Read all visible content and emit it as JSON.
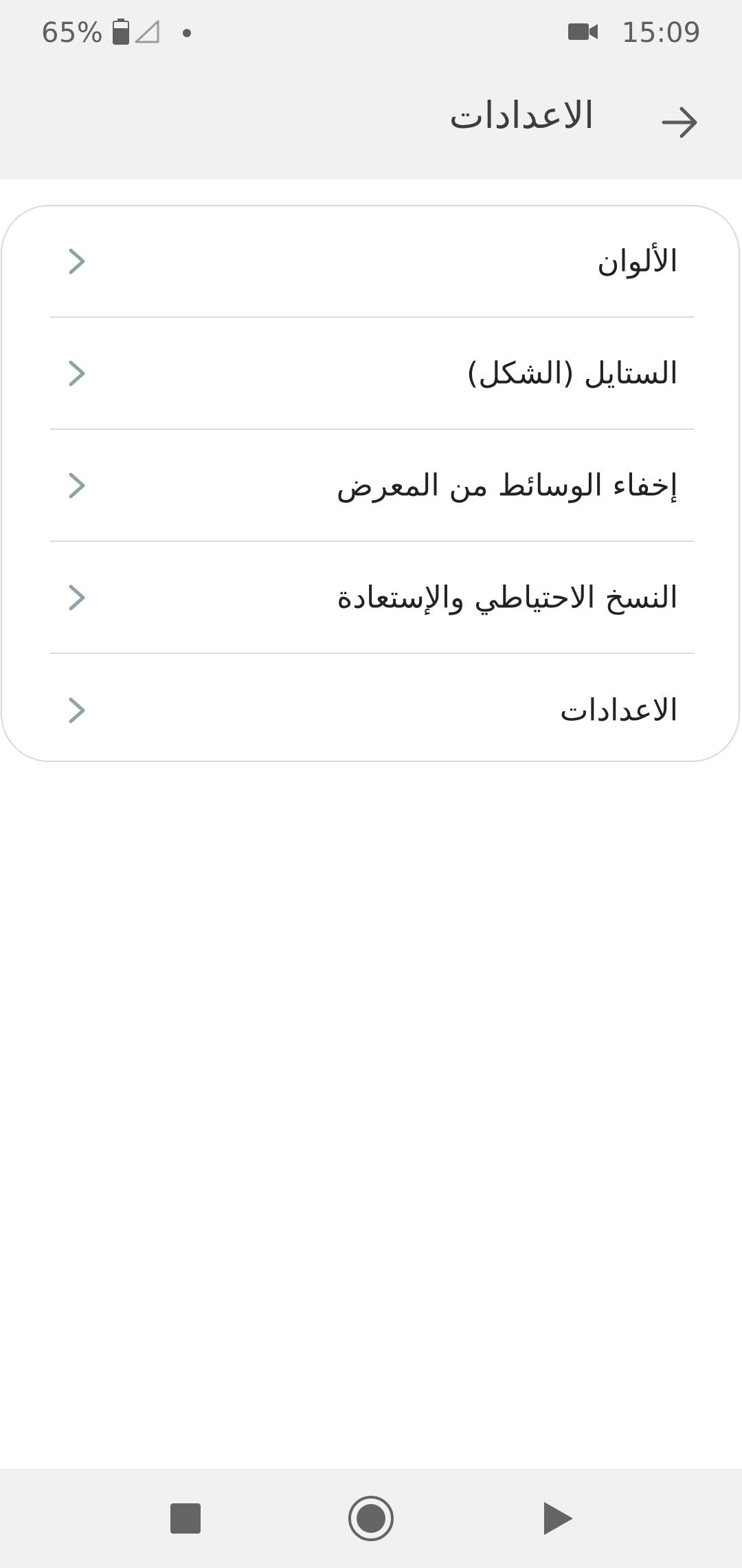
{
  "status_bar": {
    "battery_percent": "65%",
    "time": "15:09",
    "icons": [
      "battery-icon",
      "signal-icon",
      "notification-dot-icon",
      "video-camera-icon"
    ]
  },
  "app_bar": {
    "title": "الاعدادات",
    "back_icon": "arrow-right-icon"
  },
  "menu": {
    "items": [
      {
        "label": "الألوان"
      },
      {
        "label": "الستايل (الشكل)"
      },
      {
        "label": "إخفاء الوسائط من المعرض"
      },
      {
        "label": "النسخ الاحتياطي والإستعادة"
      },
      {
        "label": "الاعدادات"
      }
    ],
    "chevron_icon": "chevron-left-icon"
  },
  "nav_bar": {
    "icons": [
      "recents-square-icon",
      "home-circle-icon",
      "back-triangle-icon"
    ]
  },
  "colors": {
    "bar_background": "#f1f1f1",
    "chevron": "#8fa3a6",
    "text": "#222222",
    "divider": "#dcdcdc"
  }
}
